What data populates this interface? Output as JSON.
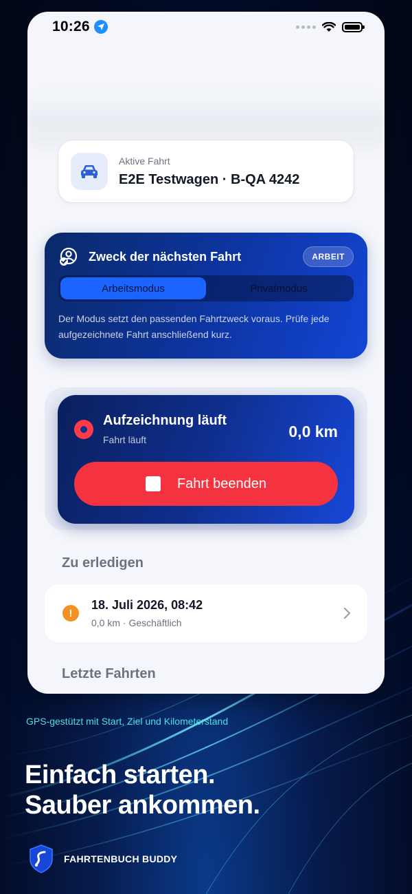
{
  "status_bar": {
    "time": "10:26"
  },
  "active_trip": {
    "caption": "Aktive Fahrt",
    "vehicle": "E2E Testwagen · B-QA 4242"
  },
  "purpose": {
    "title": "Zweck der nächsten Fahrt",
    "badge": "ARBEIT",
    "modes": [
      "Arbeitsmodus",
      "Privatmodus"
    ],
    "selected_mode": "Arbeitsmodus",
    "description": "Der Modus setzt den passenden Fahrtzweck voraus. Prüfe jede aufgezeichnete Fahrt anschließend kurz."
  },
  "recording": {
    "title": "Aufzeichnung läuft",
    "subtitle": "Fahrt läuft",
    "distance": "0,0 km",
    "stop_label": "Fahrt beenden"
  },
  "todo": {
    "section_title": "Zu erledigen",
    "items": [
      {
        "title": "18. Juli 2026, 08:42",
        "subtitle": "0,0 km · Geschäftlich"
      }
    ]
  },
  "recent": {
    "section_title": "Letzte Fahrten"
  },
  "promo": {
    "tagline": "GPS-gestützt mit Start, Ziel und Kilometerstand",
    "headline_line1": "Einfach starten.",
    "headline_line2": "Sauber ankommen.",
    "brand": "FAHRTENBUCH BUDDY"
  },
  "colors": {
    "accent_blue": "#1b64ff",
    "stop_red": "#f5323f",
    "warning_orange": "#f39121",
    "tagline_cyan": "#49e0e6"
  }
}
